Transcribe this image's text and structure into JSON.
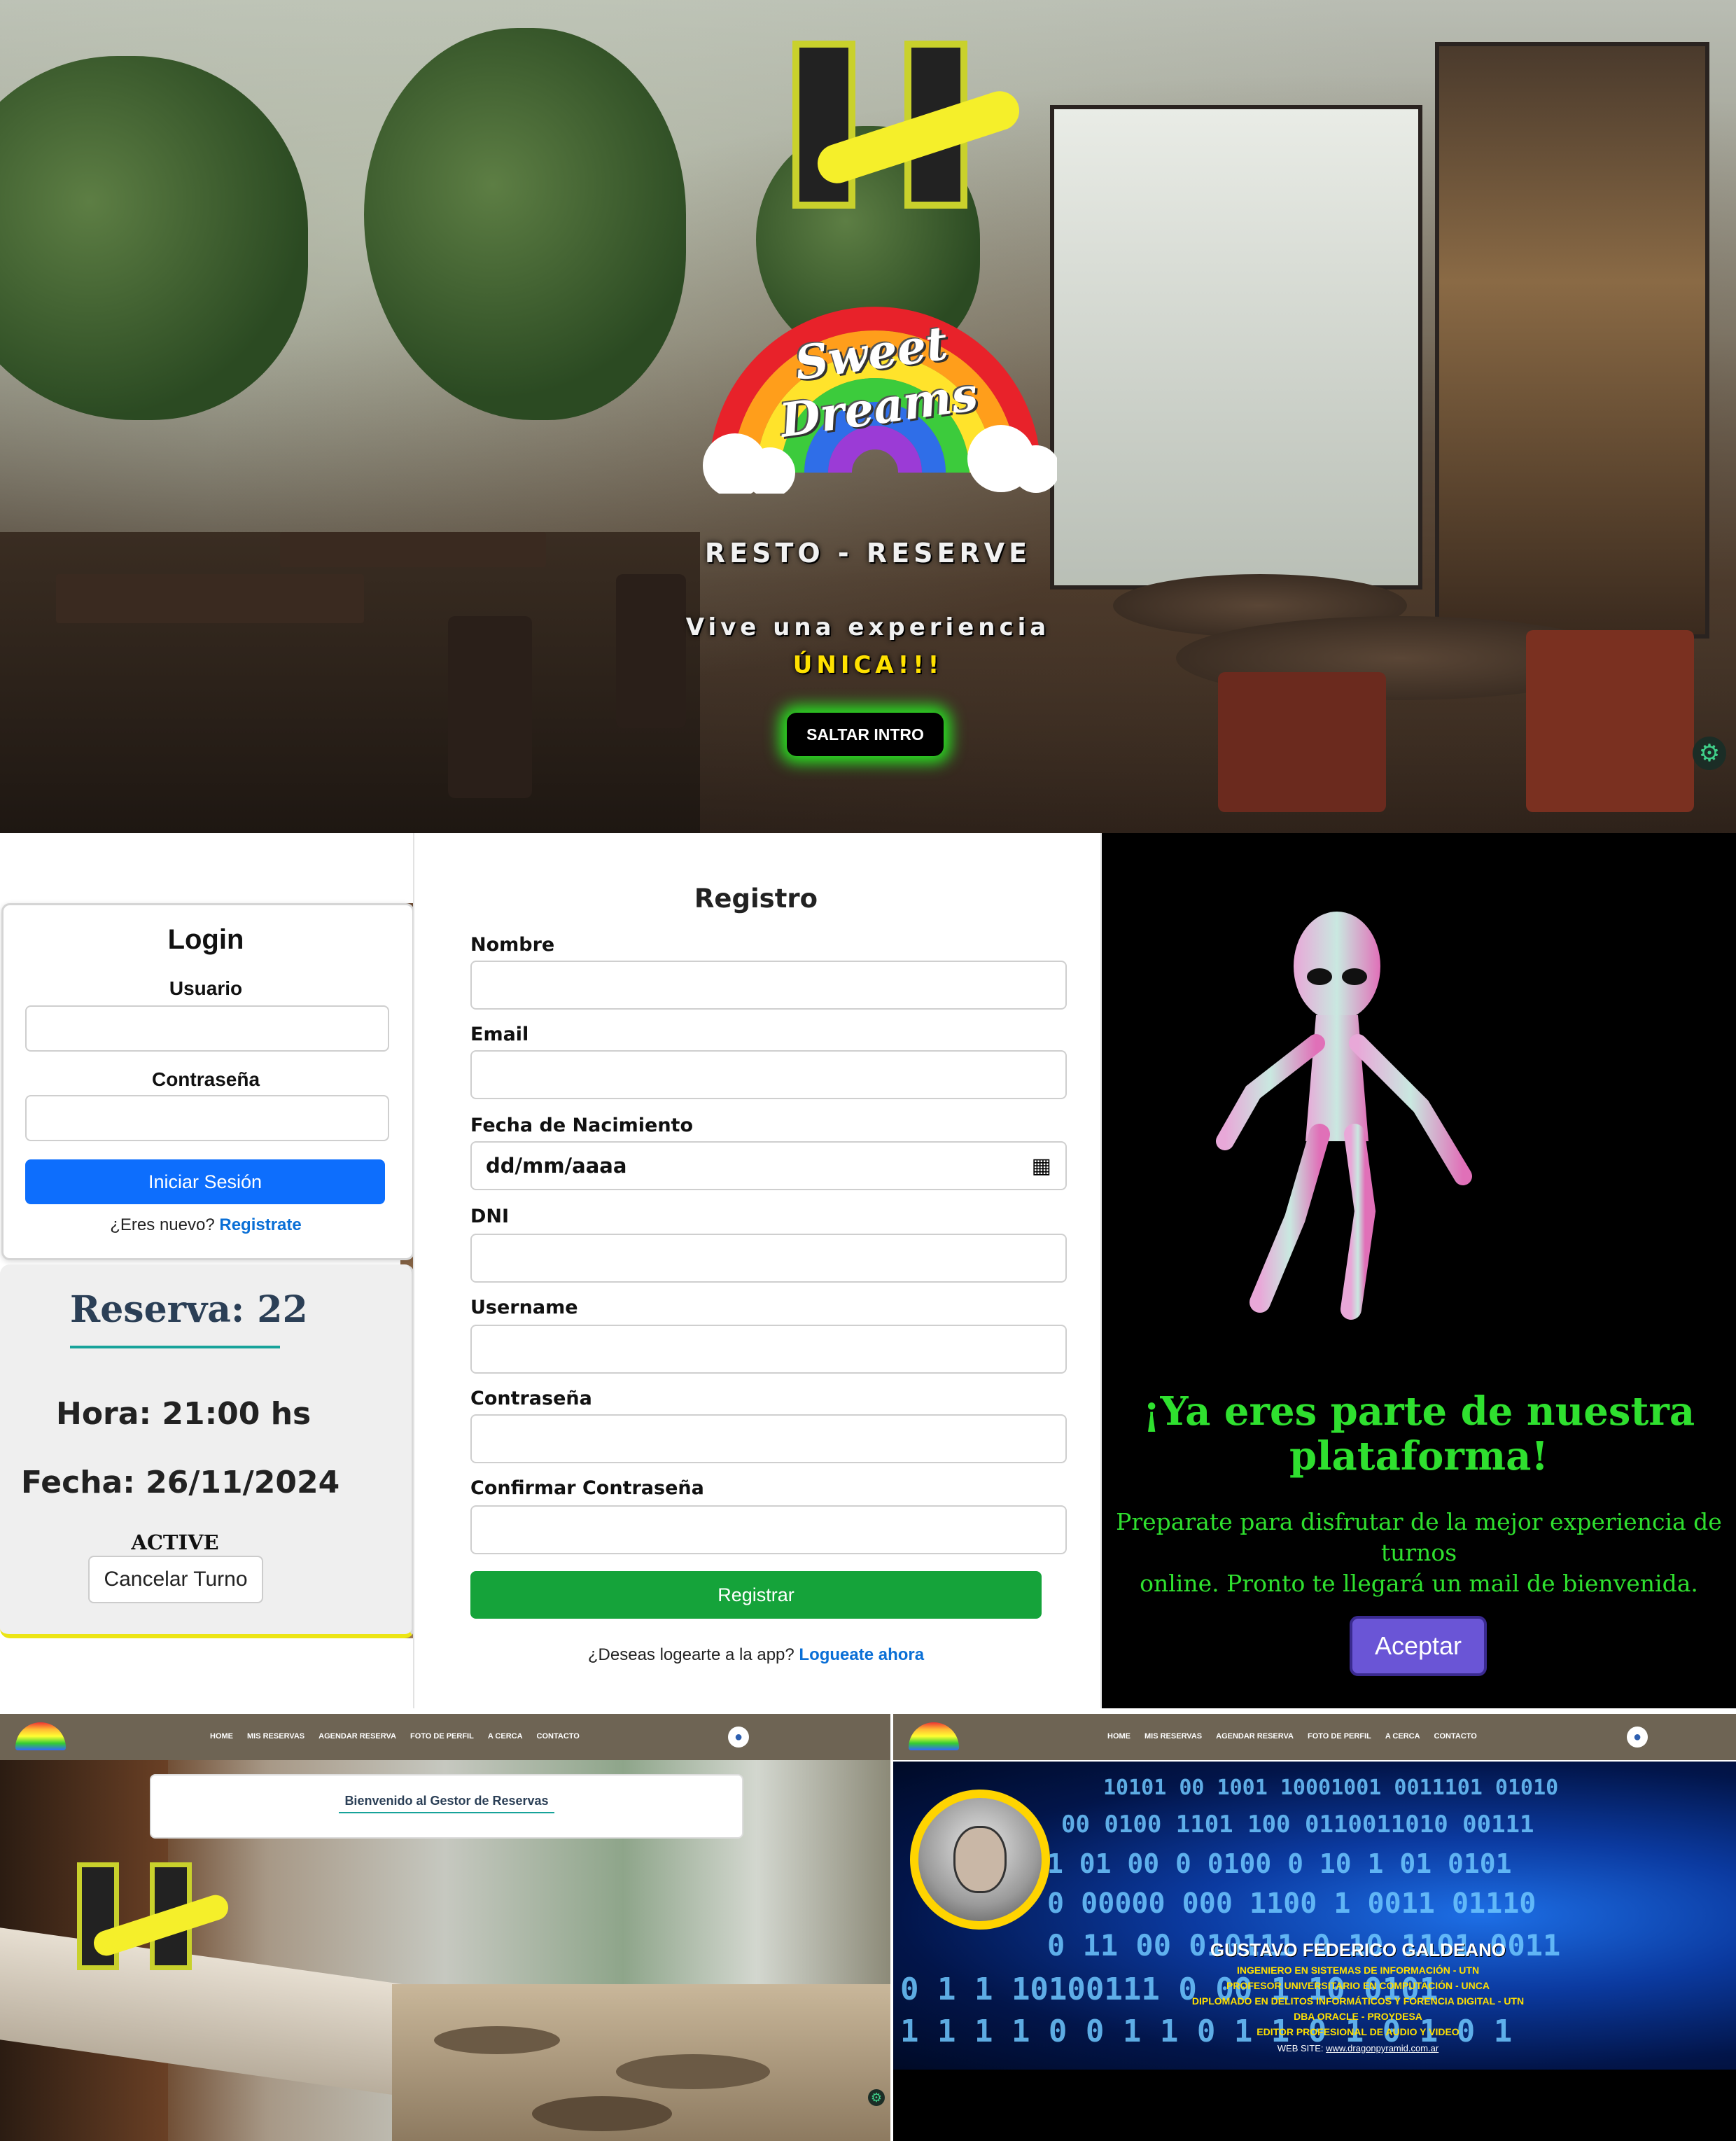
{
  "hero": {
    "brand": "RESTO - RESERVE",
    "logo_text": "Sweet Dreams",
    "tagline_line1": "Vive una experiencia",
    "tagline_line2": "ÚNICA!!!",
    "skip_button": "SALTAR INTRO",
    "glow_color": "#29e322"
  },
  "login": {
    "title": "Login",
    "user_label": "Usuario",
    "password_label": "Contraseña",
    "submit": "Iniciar Sesión",
    "new_prompt": "¿Eres nuevo?",
    "register_link": "Registrate",
    "accent": "#0d6efd"
  },
  "reserva": {
    "title": "Reserva: 22",
    "hora": "Hora: 21:00 hs",
    "fecha": "Fecha: 26/11/2024",
    "status": "ACTIVE",
    "cancel": "Cancelar Turno"
  },
  "registro": {
    "title": "Registro",
    "fields": {
      "nombre": "Nombre",
      "email": "Email",
      "nacimiento": "Fecha de Nacimiento",
      "dni": "DNI",
      "username": "Username",
      "password": "Contraseña",
      "confirm": "Confirmar Contraseña"
    },
    "date_placeholder": "dd/mm/aaaa",
    "submit": "Registrar",
    "login_prompt": "¿Deseas logearte a la app?",
    "login_link": "Logueate ahora",
    "accent": "#15a33a"
  },
  "success": {
    "heading_line1": "¡Ya eres parte de nuestra",
    "heading_line2": "plataforma!",
    "text_line1": "Preparate para disfrutar de la mejor experiencia de turnos",
    "text_line2": "online. Pronto te llegará un mail de bienvenida.",
    "accept": "Aceptar",
    "color": "#2fe02f"
  },
  "nav": {
    "items": [
      "HOME",
      "MIS RESERVAS",
      "AGENDAR RESERVA",
      "FOTO DE PERFIL",
      "A CERCA",
      "CONTACTO"
    ]
  },
  "welcome": {
    "title": "Bienvenido al Gestor de Reservas"
  },
  "about": {
    "name": "GUSTAVO FEDERICO GALDEANO",
    "lines": [
      "INGENIERO EN SISTEMAS DE INFORMACIÓN - UTN",
      "PROFESOR UNIVERSITARIO EN COMPUTACIÓN - UNCA",
      "DIPLOMADO EN DELITOS INFORMÁTICOS Y FORENCIA DIGITAL - UTN",
      "DBA ORACLE - PROYDESA",
      "EDITOR PROFESIONAL DE AUDIO Y VIDEO"
    ],
    "web_label": "WEB SITE:",
    "web_url": "www.dragonpyramid.com.ar"
  }
}
